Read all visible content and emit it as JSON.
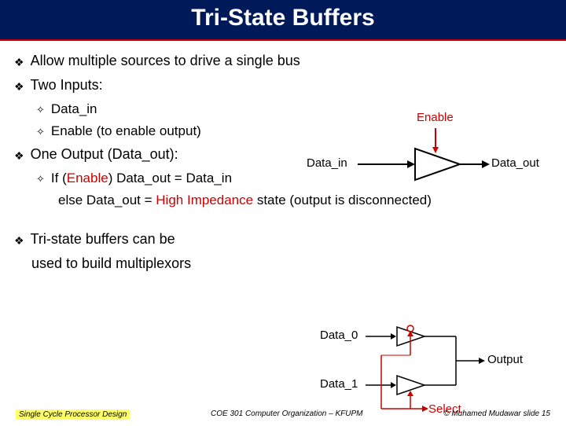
{
  "title": "Tri-State Buffers",
  "bullets": {
    "b1": "Allow multiple sources to drive a single bus",
    "b2": "Two Inputs:",
    "b2a": "Data_in",
    "b2b": "Enable (to enable output)",
    "b3": "One Output (Data_out):",
    "b3a_pre": "If (",
    "b3a_enable": "Enable",
    "b3a_post": ") Data_out = Data_in",
    "b3b_pre": "else Data_out = ",
    "b3b_hi": "High Impedance",
    "b3b_post": " state (output is disconnected)",
    "b4": "Tri-state buffers can be",
    "b4_line2": "used to build multiplexors"
  },
  "diagram1": {
    "enable": "Enable",
    "data_in": "Data_in",
    "data_out": "Data_out"
  },
  "diagram2": {
    "data_0": "Data_0",
    "data_1": "Data_1",
    "output": "Output",
    "select": "Select"
  },
  "footer": {
    "left": "Single Cycle Processor Design",
    "center": "COE 301 Computer Organization – KFUPM",
    "right": "© Muhamed Mudawar slide 15"
  }
}
